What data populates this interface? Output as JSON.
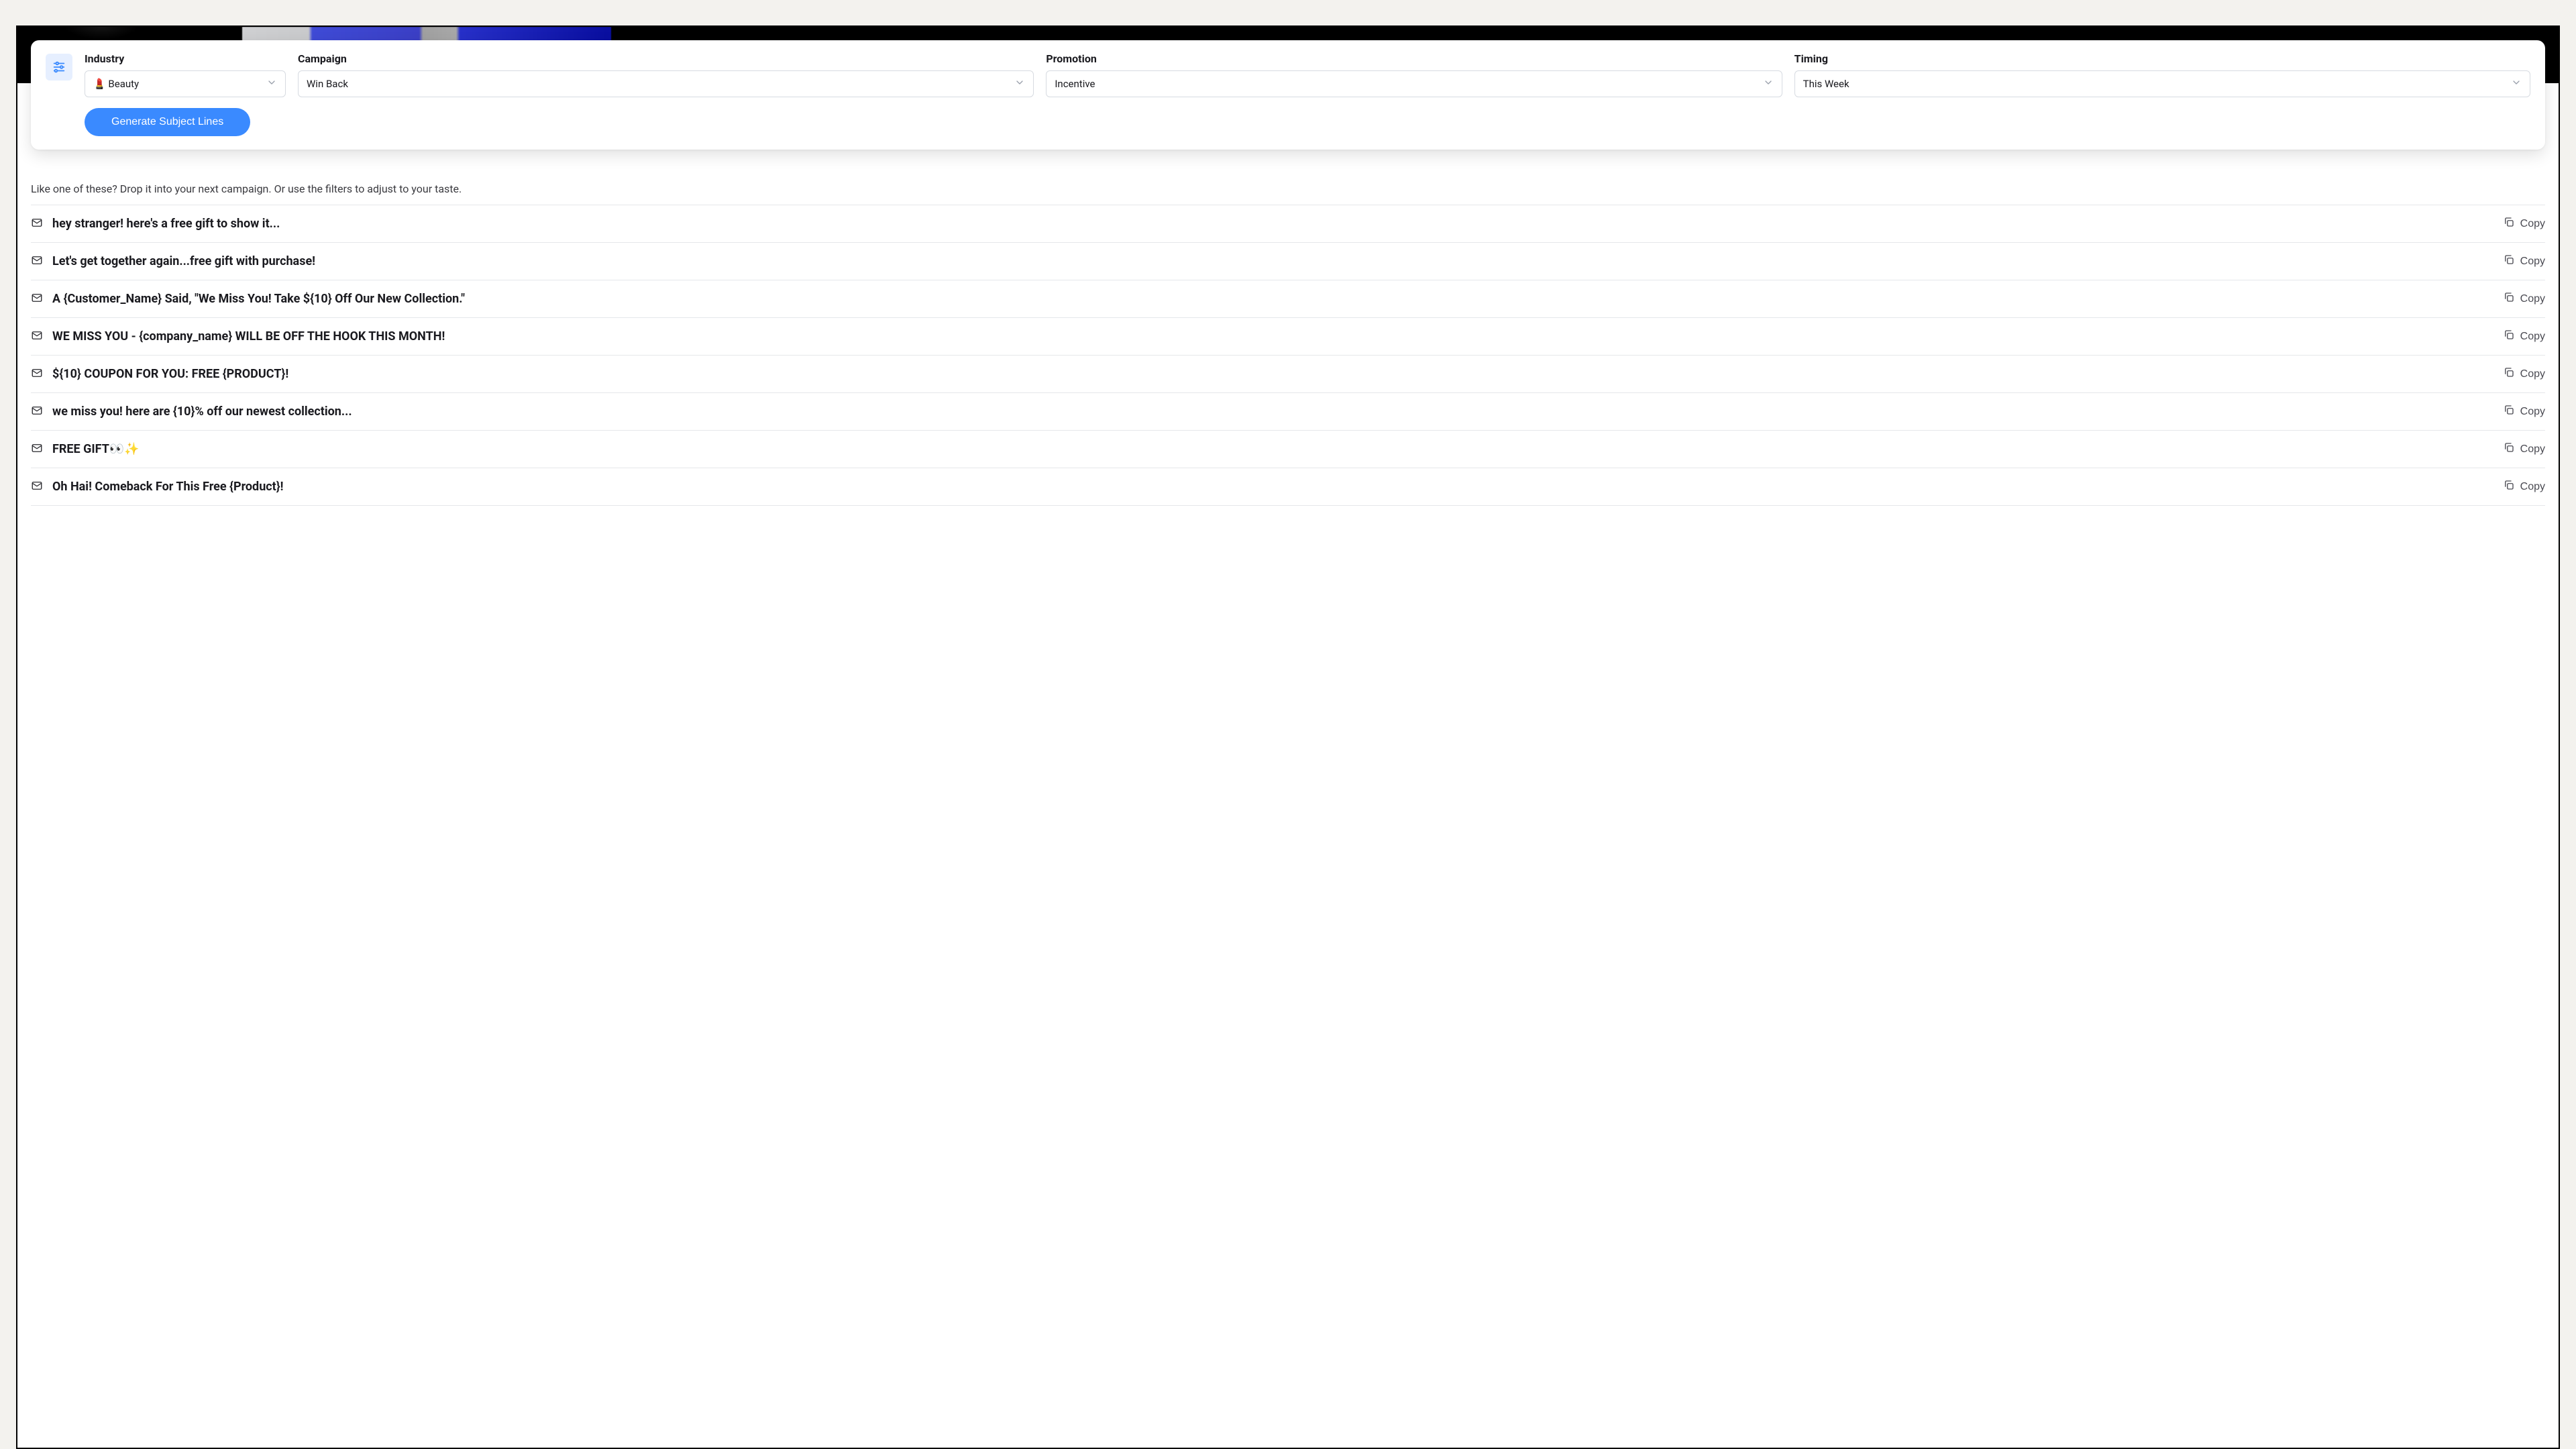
{
  "filters": {
    "industry": {
      "label": "Industry",
      "value": "💄 Beauty"
    },
    "campaign": {
      "label": "Campaign",
      "value": "Win Back"
    },
    "promotion": {
      "label": "Promotion",
      "value": "Incentive"
    },
    "timing": {
      "label": "Timing",
      "value": "This Week"
    }
  },
  "generate_label": "Generate Subject Lines",
  "hint": "Like one of these? Drop it into your next campaign. Or use the filters to adjust to your taste.",
  "copy_label": "Copy",
  "results": [
    "hey stranger! here's a free gift to show it...",
    "Let's get together again...free gift with purchase!",
    "A {Customer_Name} Said, \"We Miss You! Take ${10} Off Our New Collection.\"",
    "WE MISS YOU - {company_name} WILL BE OFF THE HOOK THIS MONTH!",
    "${10} COUPON FOR YOU: FREE {PRODUCT}!",
    "we miss you! here are {10}% off our newest collection...",
    "FREE GIFT👀✨",
    "Oh Hai! Comeback For This Free {Product}!"
  ]
}
